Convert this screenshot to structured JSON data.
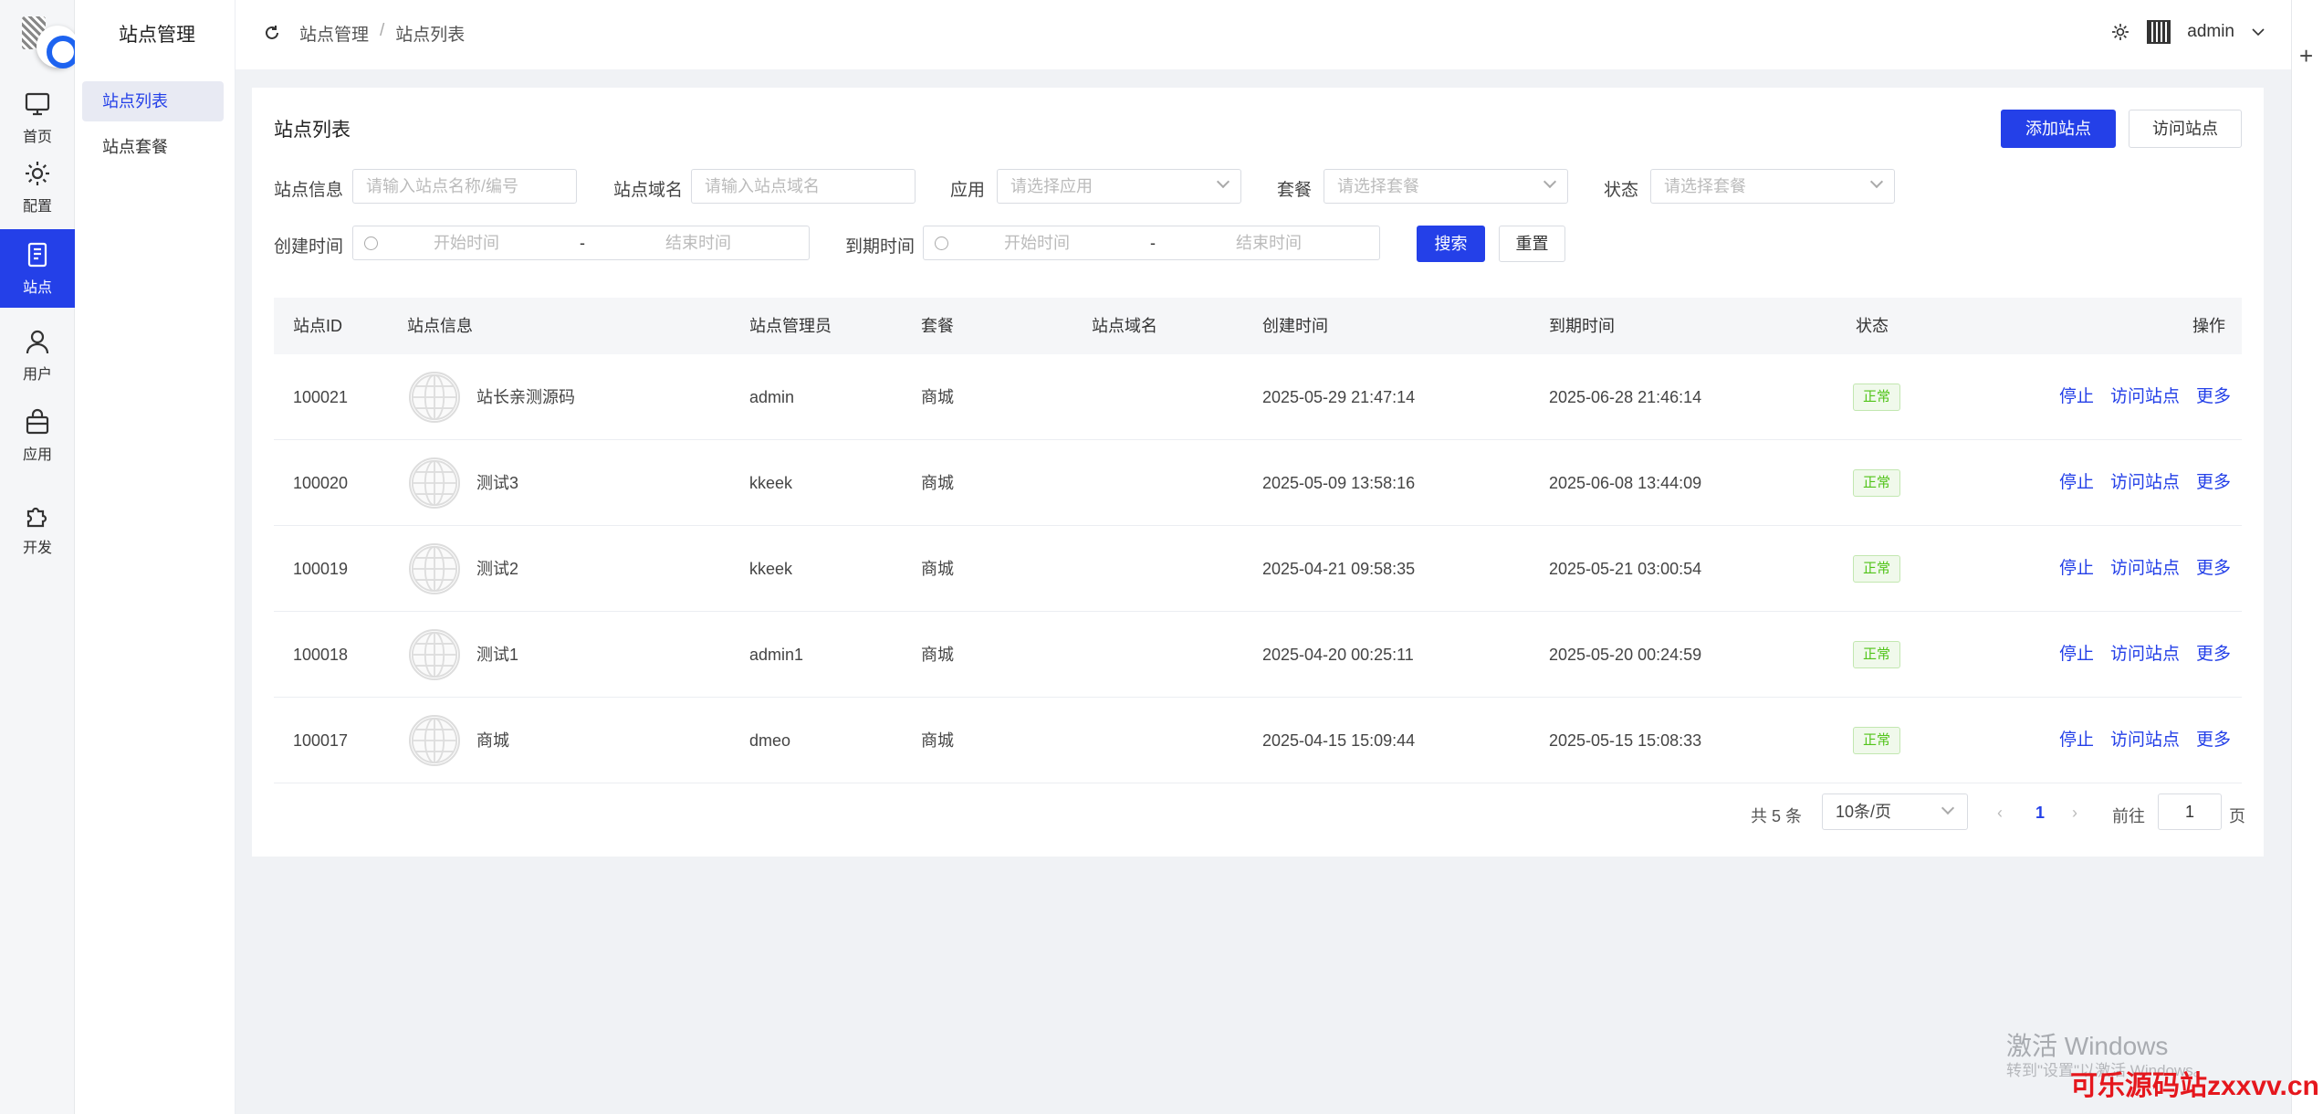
{
  "rail": [
    {
      "label": "首页",
      "icon": "monitor-icon"
    },
    {
      "label": "配置",
      "icon": "gear-icon"
    },
    {
      "label": "站点",
      "icon": "document-icon",
      "active": true
    },
    {
      "label": "用户",
      "icon": "user-icon"
    },
    {
      "label": "应用",
      "icon": "bag-icon"
    },
    {
      "label": "开发",
      "icon": "puzzle-icon"
    }
  ],
  "submenu": {
    "title": "站点管理",
    "items": [
      "站点列表",
      "站点套餐"
    ]
  },
  "header": {
    "breadcrumb": [
      "站点管理",
      "站点列表"
    ],
    "user": "admin"
  },
  "page": {
    "title": "站点列表",
    "add_button": "添加站点",
    "visit_button": "访问站点"
  },
  "filters": {
    "site_info_label": "站点信息",
    "site_info_placeholder": "请输入站点名称/编号",
    "domain_label": "站点域名",
    "domain_placeholder": "请输入站点域名",
    "app_label": "应用",
    "app_placeholder": "请选择应用",
    "package_label": "套餐",
    "package_placeholder": "请选择套餐",
    "status_label": "状态",
    "status_placeholder": "请选择套餐",
    "created_label": "创建时间",
    "expire_label": "到期时间",
    "start_placeholder": "开始时间",
    "end_placeholder": "结束时间",
    "range_sep": "-",
    "search_button": "搜索",
    "reset_button": "重置"
  },
  "table": {
    "columns": [
      "站点ID",
      "站点信息",
      "站点管理员",
      "套餐",
      "站点域名",
      "创建时间",
      "到期时间",
      "状态",
      "操作"
    ],
    "actions": [
      "停止",
      "访问站点",
      "更多"
    ],
    "rows": [
      {
        "id": "100021",
        "name": "站长亲测源码",
        "admin": "admin",
        "package": "商城",
        "domain": "",
        "created": "2025-05-29 21:47:14",
        "expire": "2025-06-28 21:46:14",
        "status": "正常"
      },
      {
        "id": "100020",
        "name": "测试3",
        "admin": "kkeek",
        "package": "商城",
        "domain": "",
        "created": "2025-05-09 13:58:16",
        "expire": "2025-06-08 13:44:09",
        "status": "正常"
      },
      {
        "id": "100019",
        "name": "测试2",
        "admin": "kkeek",
        "package": "商城",
        "domain": "",
        "created": "2025-04-21 09:58:35",
        "expire": "2025-05-21 03:00:54",
        "status": "正常"
      },
      {
        "id": "100018",
        "name": "测试1",
        "admin": "admin1",
        "package": "商城",
        "domain": "",
        "created": "2025-04-20 00:25:11",
        "expire": "2025-05-20 00:24:59",
        "status": "正常"
      },
      {
        "id": "100017",
        "name": "商城",
        "admin": "dmeo",
        "package": "商城",
        "domain": "",
        "created": "2025-04-15 15:09:44",
        "expire": "2025-05-15 15:08:33",
        "status": "正常"
      }
    ]
  },
  "pagination": {
    "total": "共 5 条",
    "page_size": "10条/页",
    "current": "1",
    "goto_label": "前往",
    "goto_value": "1",
    "page_suffix": "页"
  },
  "watermark": {
    "line1": "激活 Windows",
    "line2": "转到\"设置\"以激活 Windows。",
    "brand": "可乐源码站zxxvv.cn"
  },
  "colors": {
    "accent": "#2440e8",
    "status_ok": "#52c41a"
  }
}
